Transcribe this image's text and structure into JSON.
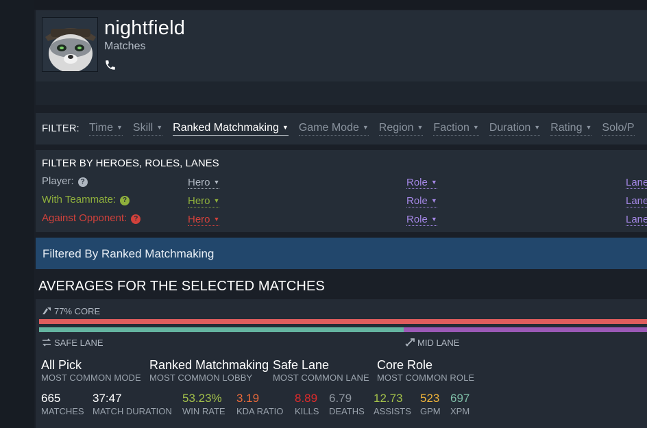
{
  "profile": {
    "name": "nightfield",
    "subtitle": "Matches",
    "phone_icon": "phone-icon"
  },
  "filters": {
    "label": "FILTER:",
    "items": [
      {
        "label": "Time",
        "active": false
      },
      {
        "label": "Skill",
        "active": false
      },
      {
        "label": "Ranked Matchmaking",
        "active": true
      },
      {
        "label": "Game Mode",
        "active": false
      },
      {
        "label": "Region",
        "active": false
      },
      {
        "label": "Faction",
        "active": false
      },
      {
        "label": "Duration",
        "active": false
      },
      {
        "label": "Rating",
        "active": false
      },
      {
        "label": "Solo/P",
        "active": false
      }
    ]
  },
  "hero_filters": {
    "title": "FILTER BY HEROES, ROLES, LANES",
    "rows": [
      {
        "label": "Player:",
        "hero": "Hero",
        "role": "Role",
        "lane": "Lane"
      },
      {
        "label": "With Teammate:",
        "hero": "Hero",
        "role": "Role",
        "lane": "Lane"
      },
      {
        "label": "Against Opponent:",
        "hero": "Hero",
        "role": "Role",
        "lane": "Lane"
      }
    ]
  },
  "banner": "Filtered By Ranked Matchmaking",
  "averages": {
    "title": "AVERAGES FOR THE SELECTED MATCHES",
    "core_label": "77% CORE",
    "core_fraction": 0.77,
    "safe_lane_label": "SAFE LANE",
    "mid_lane_label": "MID LANE",
    "safe_lane_fraction": 0.6,
    "common": [
      {
        "value": "All Pick",
        "key": "MOST COMMON MODE"
      },
      {
        "value": "Ranked Matchmaking",
        "key": "MOST COMMON LOBBY"
      },
      {
        "value": "Safe Lane",
        "key": "MOST COMMON LANE"
      },
      {
        "value": "Core Role",
        "key": "MOST COMMON ROLE"
      }
    ],
    "stats": [
      {
        "value": "665",
        "key": "MATCHES",
        "color": "#ffffff"
      },
      {
        "value": "37:47",
        "key": "MATCH DURATION",
        "color": "#ffffff"
      },
      {
        "value": "53.23%",
        "key": "WIN RATE",
        "color": "#a3c14a"
      },
      {
        "value": "3.19",
        "key": "KDA RATIO",
        "color": "#e96a3a"
      },
      {
        "value": "8.89",
        "key": "KILLS",
        "color": "#e02b2b"
      },
      {
        "value": "6.79",
        "key": "DEATHS",
        "color": "#8e969f"
      },
      {
        "value": "12.73",
        "key": "ASSISTS",
        "color": "#a3c14a"
      },
      {
        "value": "523",
        "key": "GPM",
        "color": "#f0b43a"
      },
      {
        "value": "697",
        "key": "XPM",
        "color": "#7fbfa8"
      }
    ]
  },
  "colors": {
    "core_bar": "#e05d5d",
    "safe_bar": "#64b4a0",
    "mid_bar": "#9b59b6",
    "banner": "#22476c",
    "role_link": "#a487e6"
  }
}
